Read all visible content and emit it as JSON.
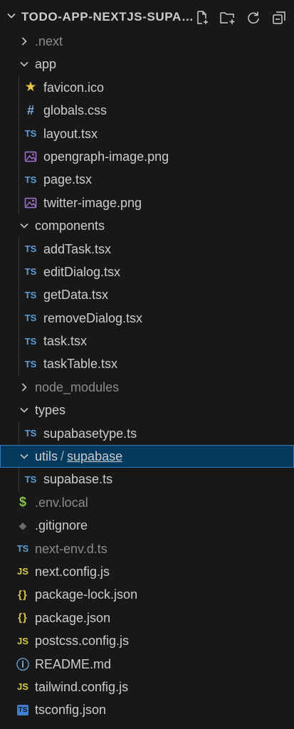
{
  "explorer": {
    "title": "TODO-APP-NEXTJS-SUPAB...",
    "actions": [
      "new-file-icon",
      "new-folder-icon",
      "refresh-icon",
      "collapse-all-icon"
    ]
  },
  "tree": [
    {
      "name": "folder-next",
      "label": ".next",
      "depth": 0,
      "kind": "folder",
      "open": false,
      "dim": true
    },
    {
      "name": "folder-app",
      "label": "app",
      "depth": 0,
      "kind": "folder",
      "open": true
    },
    {
      "name": "file-favicon",
      "label": "favicon.ico",
      "depth": 1,
      "kind": "file",
      "icon": "star-icon",
      "glyph": "★",
      "color": "#e8c547"
    },
    {
      "name": "file-globals-css",
      "label": "globals.css",
      "depth": 1,
      "kind": "file",
      "icon": "hash-icon",
      "glyph": "#",
      "color": "#7fa7d6"
    },
    {
      "name": "file-layout-tsx",
      "label": "layout.tsx",
      "depth": 1,
      "kind": "file",
      "icon": "typescript-icon",
      "glyph": "TS",
      "color": "#5d9fd6"
    },
    {
      "name": "file-opengraph-image",
      "label": "opengraph-image.png",
      "depth": 1,
      "kind": "file",
      "icon": "image-icon",
      "glyph": "img",
      "color": "#a575d6"
    },
    {
      "name": "file-page-tsx",
      "label": "page.tsx",
      "depth": 1,
      "kind": "file",
      "icon": "typescript-icon",
      "glyph": "TS",
      "color": "#5d9fd6"
    },
    {
      "name": "file-twitter-image",
      "label": "twitter-image.png",
      "depth": 1,
      "kind": "file",
      "icon": "image-icon",
      "glyph": "img",
      "color": "#a575d6"
    },
    {
      "name": "folder-components",
      "label": "components",
      "depth": 0,
      "kind": "folder",
      "open": true
    },
    {
      "name": "file-addtask",
      "label": "addTask.tsx",
      "depth": 1,
      "kind": "file",
      "icon": "typescript-icon",
      "glyph": "TS",
      "color": "#5d9fd6"
    },
    {
      "name": "file-editdialog",
      "label": "editDialog.tsx",
      "depth": 1,
      "kind": "file",
      "icon": "typescript-icon",
      "glyph": "TS",
      "color": "#5d9fd6"
    },
    {
      "name": "file-getdata",
      "label": "getData.tsx",
      "depth": 1,
      "kind": "file",
      "icon": "typescript-icon",
      "glyph": "TS",
      "color": "#5d9fd6"
    },
    {
      "name": "file-removedialog",
      "label": "removeDialog.tsx",
      "depth": 1,
      "kind": "file",
      "icon": "typescript-icon",
      "glyph": "TS",
      "color": "#5d9fd6"
    },
    {
      "name": "file-task",
      "label": "task.tsx",
      "depth": 1,
      "kind": "file",
      "icon": "typescript-icon",
      "glyph": "TS",
      "color": "#5d9fd6"
    },
    {
      "name": "file-tasktable",
      "label": "taskTable.tsx",
      "depth": 1,
      "kind": "file",
      "icon": "typescript-icon",
      "glyph": "TS",
      "color": "#5d9fd6"
    },
    {
      "name": "folder-node-modules",
      "label": "node_modules",
      "depth": 0,
      "kind": "folder",
      "open": false,
      "dim": true
    },
    {
      "name": "folder-types",
      "label": "types",
      "depth": 0,
      "kind": "folder",
      "open": true
    },
    {
      "name": "file-supabasetype",
      "label": "supabasetype.ts",
      "depth": 1,
      "kind": "file",
      "icon": "typescript-icon",
      "glyph": "TS",
      "color": "#5d9fd6"
    },
    {
      "name": "folder-utils-supabase",
      "label": "utils",
      "label2": "supabase",
      "depth": 0,
      "kind": "folder",
      "open": true,
      "selected": true
    },
    {
      "name": "file-supabase-ts",
      "label": "supabase.ts",
      "depth": 1,
      "kind": "file",
      "icon": "typescript-icon",
      "glyph": "TS",
      "color": "#5d9fd6"
    },
    {
      "name": "file-env-local",
      "label": ".env.local",
      "depth": 0,
      "kind": "file",
      "icon": "dollar-icon",
      "glyph": "$",
      "color": "#8bc34a",
      "dim": true
    },
    {
      "name": "file-gitignore",
      "label": ".gitignore",
      "depth": 0,
      "kind": "file",
      "icon": "git-icon",
      "glyph": "◆",
      "color": "#6a6a6a"
    },
    {
      "name": "file-next-env",
      "label": "next-env.d.ts",
      "depth": 0,
      "kind": "file",
      "icon": "typescript-icon",
      "glyph": "TS",
      "color": "#5d9fd6",
      "dim": true
    },
    {
      "name": "file-next-config",
      "label": "next.config.js",
      "depth": 0,
      "kind": "file",
      "icon": "javascript-icon",
      "glyph": "JS",
      "color": "#d7c94a"
    },
    {
      "name": "file-package-lock",
      "label": "package-lock.json",
      "depth": 0,
      "kind": "file",
      "icon": "json-icon",
      "glyph": "{}",
      "color": "#d7c94a"
    },
    {
      "name": "file-package-json",
      "label": "package.json",
      "depth": 0,
      "kind": "file",
      "icon": "json-icon",
      "glyph": "{}",
      "color": "#d7c94a"
    },
    {
      "name": "file-postcss-config",
      "label": "postcss.config.js",
      "depth": 0,
      "kind": "file",
      "icon": "javascript-icon",
      "glyph": "JS",
      "color": "#d7c94a"
    },
    {
      "name": "file-readme",
      "label": "README.md",
      "depth": 0,
      "kind": "file",
      "icon": "info-icon",
      "glyph": "ⓘ",
      "color": "#6fa8dc"
    },
    {
      "name": "file-tailwind-config",
      "label": "tailwind.config.js",
      "depth": 0,
      "kind": "file",
      "icon": "javascript-icon",
      "glyph": "JS",
      "color": "#d7c94a"
    },
    {
      "name": "file-tsconfig",
      "label": "tsconfig.json",
      "depth": 0,
      "kind": "file",
      "icon": "tsconfig-icon",
      "glyph": "TS",
      "color": "#3f7ed1",
      "boxed": true
    }
  ]
}
